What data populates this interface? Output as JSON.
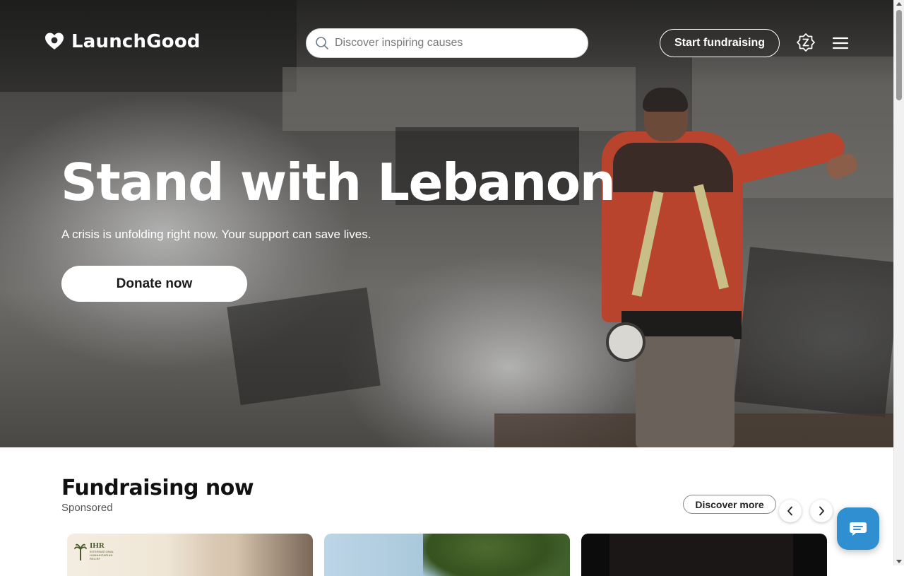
{
  "header": {
    "logo_text": "LaunchGood",
    "search_placeholder": "Discover inspiring causes",
    "start_fundraising_label": "Start fundraising",
    "zakat_icon": "zakat-icon",
    "menu_icon": "hamburger-menu-icon"
  },
  "hero": {
    "title": "Stand with Lebanon",
    "subtitle": "A crisis is unfolding right now. Your support can save lives.",
    "cta_label": "Donate now"
  },
  "fundraising": {
    "title": "Fundraising now",
    "subtitle": "Sponsored",
    "discover_label": "Discover more",
    "cards": [
      {
        "org_logo": "IHR",
        "org_logo_full": "INTERNATIONAL HUMANITARIAN RELIEF"
      },
      {
        "org_logo": ""
      },
      {
        "org_logo": ""
      }
    ]
  },
  "chat": {
    "icon": "chat-icon"
  },
  "colors": {
    "chat_button": "#2f8fd0",
    "hero_text": "#ffffff",
    "primary_dark": "#111111"
  }
}
